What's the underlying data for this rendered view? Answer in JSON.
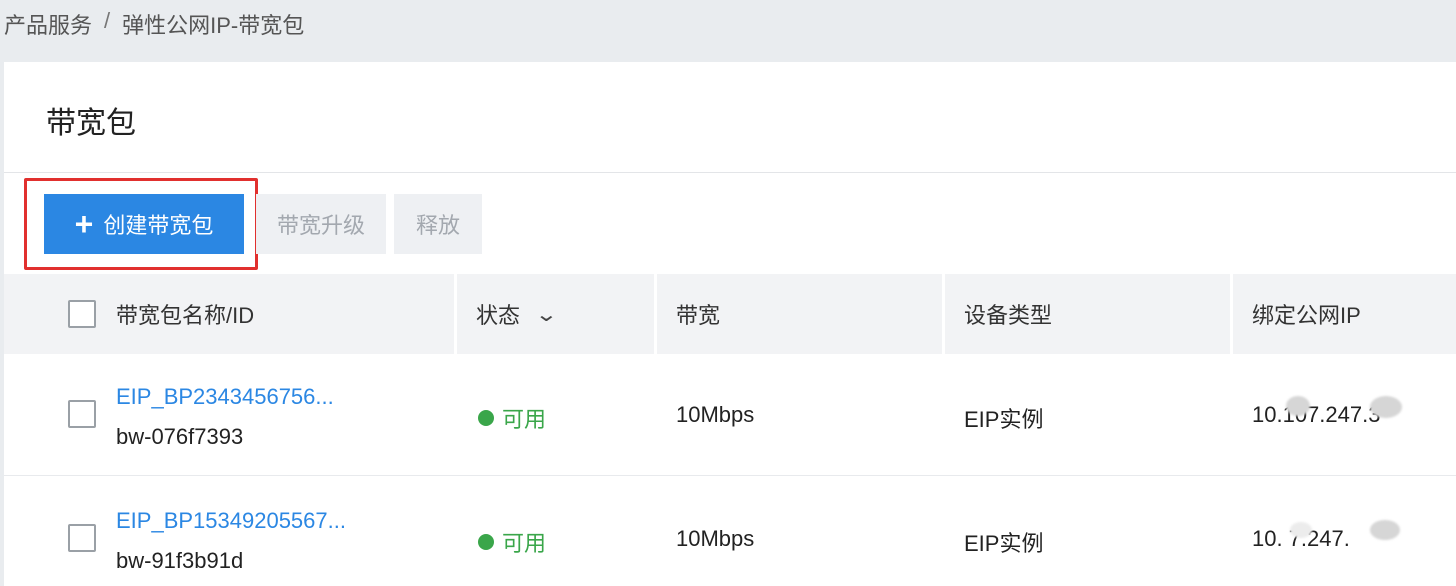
{
  "breadcrumb": {
    "items": [
      "产品服务",
      "弹性公网IP-带宽包"
    ],
    "separator": "/"
  },
  "page": {
    "title": "带宽包"
  },
  "toolbar": {
    "create_label": "创建带宽包",
    "upgrade_label": "带宽升级",
    "release_label": "释放"
  },
  "table": {
    "columns": {
      "name": "带宽包名称/ID",
      "status": "状态",
      "bandwidth": "带宽",
      "device_type": "设备类型",
      "bound_ip": "绑定公网IP"
    },
    "rows": [
      {
        "name": "EIP_BP2343456756...",
        "id": "bw-076f7393",
        "status": "可用",
        "bandwidth": "10Mbps",
        "device_type": "EIP实例",
        "ip": "10.107.247.3"
      },
      {
        "name": "EIP_BP15349205567...",
        "id": "bw-91f3b91d",
        "status": "可用",
        "bandwidth": "10Mbps",
        "device_type": "EIP实例",
        "ip": "10.  7.247."
      }
    ]
  },
  "colors": {
    "primary": "#2b87e3",
    "status_ok": "#3aa64a",
    "highlight": "#e1302e"
  }
}
